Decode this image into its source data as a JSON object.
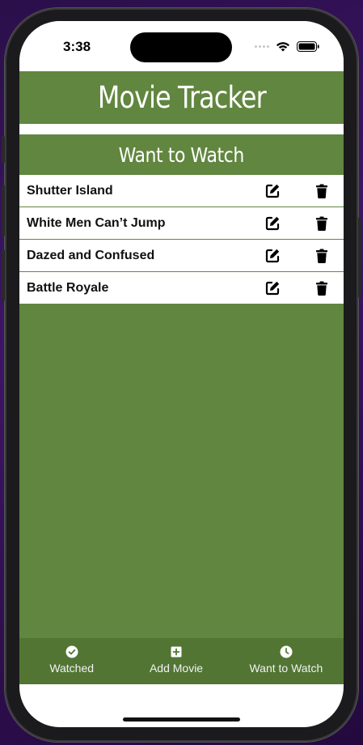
{
  "status_bar": {
    "time": "3:38"
  },
  "app": {
    "title": "Movie Tracker"
  },
  "section": {
    "title": "Want to Watch"
  },
  "movies": [
    {
      "title": "Shutter Island"
    },
    {
      "title": "White Men Can’t Jump"
    },
    {
      "title": "Dazed and Confused"
    },
    {
      "title": "Battle Royale"
    }
  ],
  "tabs": [
    {
      "label": "Watched",
      "icon": "check-circle-icon"
    },
    {
      "label": "Add Movie",
      "icon": "plus-square-icon"
    },
    {
      "label": "Want to Watch",
      "icon": "clock-icon"
    }
  ],
  "colors": {
    "accent": "#61863f",
    "tab_bar": "#527534"
  }
}
